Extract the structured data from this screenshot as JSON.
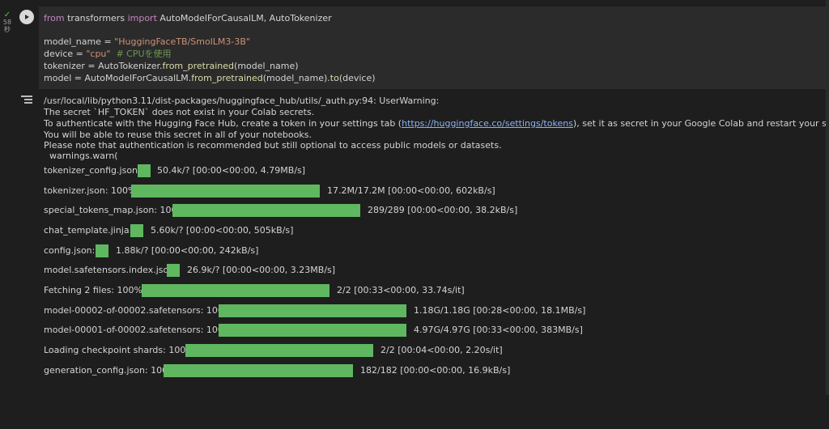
{
  "cell": {
    "status_time": "58",
    "status_unit": "秒",
    "code": {
      "line1": {
        "kw1": "from",
        "mid": " transformers ",
        "kw2": "import",
        "rest": " AutoModelForCausalLM, AutoTokenizer"
      },
      "line2": {
        "pre": "model_name = ",
        "str": "\"HuggingFaceTB/SmolLM3-3B\""
      },
      "line3": {
        "pre": "device = ",
        "str": "\"cpu\"",
        "comment": "  # CPUを使用"
      },
      "line4": {
        "pre": "tokenizer = AutoTokenizer.",
        "fn": "from_pretrained",
        "post": "(model_name)"
      },
      "line5": {
        "pre": "model = AutoModelForCausalLM.",
        "fn1": "from_pretrained",
        "mid": "(model_name).",
        "fn2": "to",
        "post": "(device)"
      }
    }
  },
  "output": {
    "warn_line1": "/usr/local/lib/python3.11/dist-packages/huggingface_hub/utils/_auth.py:94: UserWarning:",
    "warn_line2": "The secret `HF_TOKEN` does not exist in your Colab secrets.",
    "warn_line3_pre": "To authenticate with the Hugging Face Hub, create a token in your settings tab (",
    "warn_line3_link": "https://huggingface.co/settings/tokens",
    "warn_line3_post": "), set it as secret in your Google Colab and restart your session.",
    "warn_line4": "You will be able to reuse this secret in all of your notebooks.",
    "warn_line5": "Please note that authentication is recommended but still optional to access public models or datasets.",
    "warn_line6": "  warnings.warn(",
    "progress": [
      {
        "label": "tokenizer_config.json: ",
        "stats": "50.4k/? [00:00<00:00, 4.79MB/s]",
        "fill": 1.0
      },
      {
        "label": "tokenizer.json: 100%",
        "stats": "17.2M/17.2M [00:00<00:00, 602kB/s]",
        "fill": 1.0
      },
      {
        "label": "special_tokens_map.json: 100%",
        "stats": "289/289 [00:00<00:00, 38.2kB/s]",
        "fill": 1.0
      },
      {
        "label": "chat_template.jinja: ",
        "stats": "5.60k/? [00:00<00:00, 505kB/s]",
        "fill": 1.0
      },
      {
        "label": "config.json: ",
        "stats": "1.88k/? [00:00<00:00, 242kB/s]",
        "fill": 1.0
      },
      {
        "label": "model.safetensors.index.json: ",
        "stats": "26.9k/? [00:00<00:00, 3.23MB/s]",
        "fill": 1.0
      },
      {
        "label": "Fetching 2 files: 100%",
        "stats": "2/2 [00:33<00:00, 33.74s/it]",
        "fill": 1.0
      },
      {
        "label": "model-00002-of-00002.safetensors: 100%",
        "stats": "1.18G/1.18G [00:28<00:00, 18.1MB/s]",
        "fill": 1.0
      },
      {
        "label": "model-00001-of-00002.safetensors: 100%",
        "stats": "4.97G/4.97G [00:33<00:00, 383MB/s]",
        "fill": 1.0
      },
      {
        "label": "Loading checkpoint shards: 100%",
        "stats": "2/2 [00:04<00:00, 2.20s/it]",
        "fill": 1.0
      },
      {
        "label": "generation_config.json: 100%",
        "stats": "182/182 [00:00<00:00, 16.9kB/s]",
        "fill": 1.0
      }
    ]
  }
}
